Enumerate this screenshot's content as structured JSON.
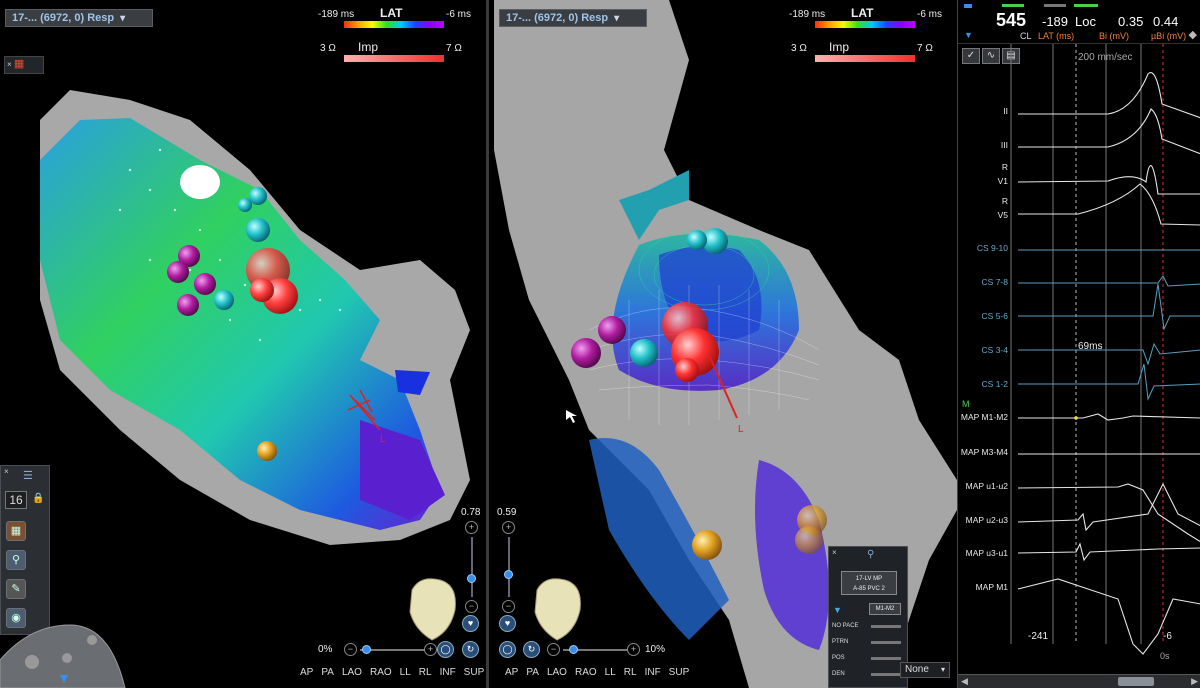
{
  "left_view": {
    "map_selector": "17-... (6972, 0) Resp",
    "lat_legend": {
      "min": "-189 ms",
      "max": "-6 ms",
      "title": "LAT"
    },
    "imp_legend": {
      "min": "3 Ω",
      "max": "7 Ω",
      "title": "Imp"
    },
    "transparency_value": "0.78",
    "opacity_pct": "0%",
    "tool_number": "16",
    "catheter_label": "L"
  },
  "mid_view": {
    "map_selector": "17-... (6972, 0) Resp",
    "lat_legend": {
      "min": "-189 ms",
      "max": "-6 ms",
      "title": "LAT"
    },
    "imp_legend": {
      "min": "3 Ω",
      "max": "7 Ω",
      "title": "Imp"
    },
    "transparency_value": "0.59",
    "opacity_pct": "10%",
    "catheter_label": "L",
    "none_select": "None",
    "overlay": {
      "map_button_line1": "17-LV MP",
      "map_button_line2": "A-85 PVC 2",
      "channel_button": "M1-M2",
      "rows": [
        "NO PACE",
        "PTRN",
        "POS",
        "DEN"
      ]
    }
  },
  "orientation_buttons": [
    "AP",
    "PA",
    "LAO",
    "RAO",
    "LL",
    "RL",
    "INF",
    "SUP"
  ],
  "ecg_panel": {
    "header": {
      "cl_value": "545",
      "cl_label": "CL",
      "lat_value": "-189",
      "lat_label": "LAT (ms)",
      "loc_label": "Loc",
      "bi_value": "0.35",
      "bi_label": "Bi (mV)",
      "ubi_value": "0.44",
      "ubi_label": "µBi (mV)"
    },
    "sweep_speed": "200 mm/sec",
    "channels": [
      {
        "label": "II",
        "color": "white"
      },
      {
        "label": "III",
        "color": "white"
      },
      {
        "label": "R\nV1",
        "color": "white"
      },
      {
        "label": "R\nV5",
        "color": "white"
      },
      {
        "label": "CS 9-10",
        "color": "blue"
      },
      {
        "label": "CS 7-8",
        "color": "blue"
      },
      {
        "label": "CS 5-6",
        "color": "blue"
      },
      {
        "label": "CS 3-4",
        "color": "blue"
      },
      {
        "label": "CS 1-2",
        "color": "blue"
      },
      {
        "label": "MAP M1-M2",
        "color": "white"
      },
      {
        "label": "MAP M3-M4",
        "color": "white"
      },
      {
        "label": "MAP u1-u2",
        "color": "white"
      },
      {
        "label": "MAP u2-u3",
        "color": "white"
      },
      {
        "label": "MAP u3-u1",
        "color": "white"
      },
      {
        "label": "MAP M1",
        "color": "white"
      }
    ],
    "m_marker": "M",
    "interval_label": "69ms",
    "window_start": "-241",
    "window_end": "-6",
    "window_end_unit": "0s"
  },
  "colors": {
    "accent": "#3a8ee8",
    "lat_red": "#ff2a10",
    "lat_purple": "#c000ff",
    "ecg_blue": "#6aa8c8",
    "marker_green": "#4bd04b"
  }
}
